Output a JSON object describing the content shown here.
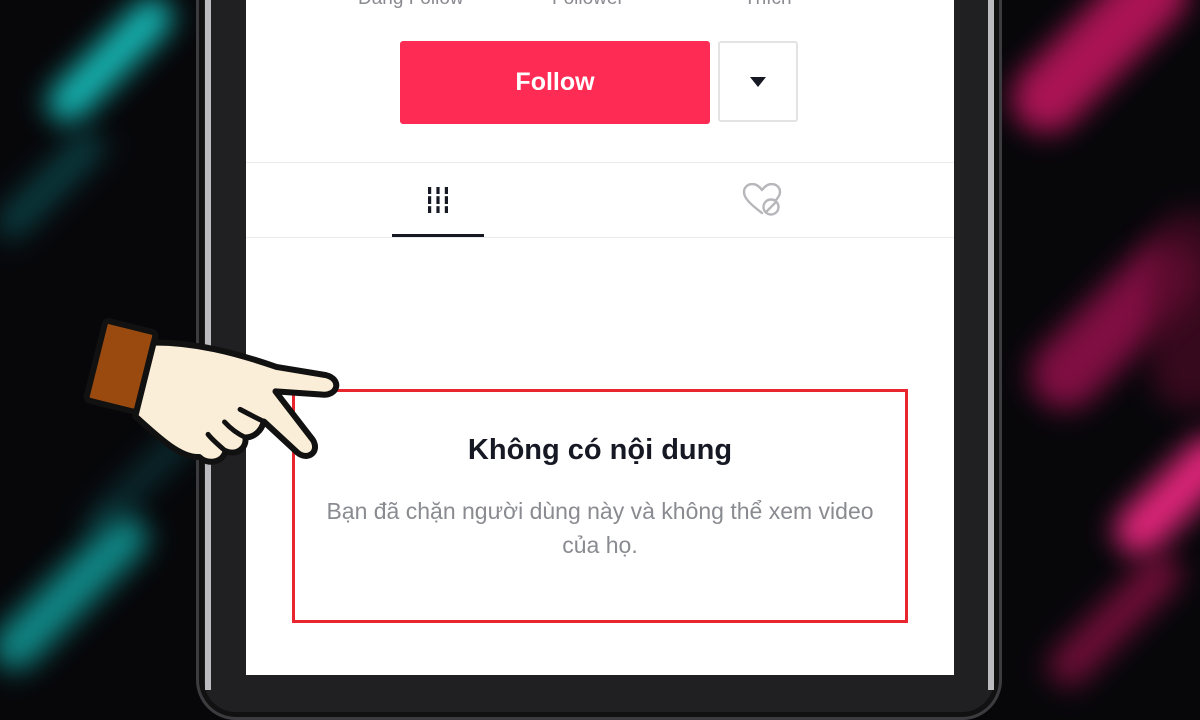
{
  "profile": {
    "stats": {
      "following_label": "Đang Follow",
      "followers_label": "Follower",
      "likes_label": "Thích"
    },
    "follow_button_label": "Follow",
    "more_options_icon": "caret-down-icon",
    "tabs": [
      {
        "name": "videos",
        "icon": "grid-columns-icon",
        "selected": true
      },
      {
        "name": "liked",
        "icon": "hidden-heart-icon",
        "selected": false
      }
    ],
    "empty_state": {
      "title": "Không có nội dung",
      "description": "Bạn đã chặn người dùng này và không thể xem video của họ."
    }
  },
  "colors": {
    "follow_button": "#fe2c55",
    "highlight_box": "#e8262e",
    "tab_indicator": "#161823",
    "secondary_text": "#8a8b91"
  },
  "annotation": {
    "pointer": "pointing-hand-icon"
  }
}
